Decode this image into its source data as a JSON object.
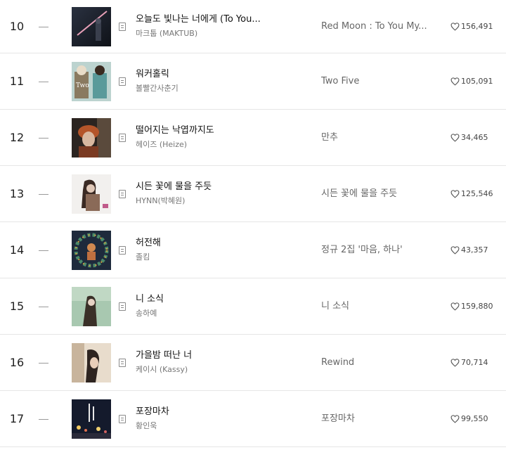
{
  "chart": {
    "rows": [
      {
        "rank": "10",
        "title": "오늘도 빛나는 너에게 (To You My Light) (Feat.이라온)",
        "title_display": "오늘도 빛나는 너에게 (To You...",
        "artist": "마크툽 (MAKTUB)",
        "album": "Red Moon : To You My...",
        "likes": "156,491"
      },
      {
        "rank": "11",
        "title": "워커홀릭",
        "title_display": "워커홀릭",
        "artist": "볼빨간사춘기",
        "album": "Two Five",
        "likes": "105,091"
      },
      {
        "rank": "12",
        "title": "떨어지는 낙엽까지도",
        "title_display": "떨어지는 낙엽까지도",
        "artist": "헤이즈 (Heize)",
        "album": "만추",
        "likes": "34,465"
      },
      {
        "rank": "13",
        "title": "시든 꽃에 물을 주듯",
        "title_display": "시든 꽃에 물을 주듯",
        "artist": "HYNN(박혜원)",
        "album": "시든 꽃에 물을 주듯",
        "likes": "125,546"
      },
      {
        "rank": "14",
        "title": "허전해",
        "title_display": "허전해",
        "artist": "졸킴",
        "album": "정규 2집 '마음, 하나'",
        "likes": "43,357"
      },
      {
        "rank": "15",
        "title": "니 소식",
        "title_display": "니 소식",
        "artist": "송하예",
        "album": "니 소식",
        "likes": "159,880"
      },
      {
        "rank": "16",
        "title": "가을밤 떠난 너",
        "title_display": "가을밤 떠난 너",
        "artist": "케이시 (Kassy)",
        "album": "Rewind",
        "likes": "70,714"
      },
      {
        "rank": "17",
        "title": "포장마차",
        "title_display": "포장마차",
        "artist": "황인욱",
        "album": "포장마차",
        "likes": "99,550"
      }
    ],
    "rank_change_icon": "dash-icon",
    "detail_icon": "song-detail-icon",
    "like_icon": "heart-outline-icon"
  }
}
